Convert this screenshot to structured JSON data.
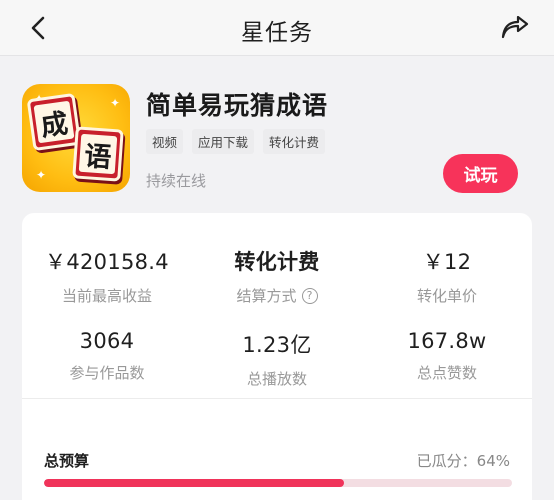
{
  "nav": {
    "title": "星任务",
    "back_icon": "back-arrow-icon",
    "share_icon": "share-icon"
  },
  "app": {
    "name": "简单易玩猜成语",
    "icon_chars": [
      "成",
      "语"
    ],
    "tags": [
      "视频",
      "应用下载",
      "转化计费"
    ],
    "status": "持续在线",
    "try_label": "试玩"
  },
  "stats": {
    "max_income": {
      "value": "￥420158.4",
      "label": "当前最高收益"
    },
    "billing": {
      "value": "转化计费",
      "label": "结算方式"
    },
    "unit_price": {
      "value": "￥12",
      "label": "转化单价"
    },
    "works": {
      "value": "3064",
      "label": "参与作品数"
    },
    "plays": {
      "value": "1.23亿",
      "label": "总播放数"
    },
    "likes": {
      "value": "167.8w",
      "label": "总点赞数"
    }
  },
  "budget": {
    "label": "总预算",
    "used_text": "已瓜分：64%",
    "progress": 0.64
  },
  "colors": {
    "accent": "#f7335a",
    "track": "#f3dde2",
    "icon_bg": "#ffbd12",
    "tile": "#c8202c"
  }
}
